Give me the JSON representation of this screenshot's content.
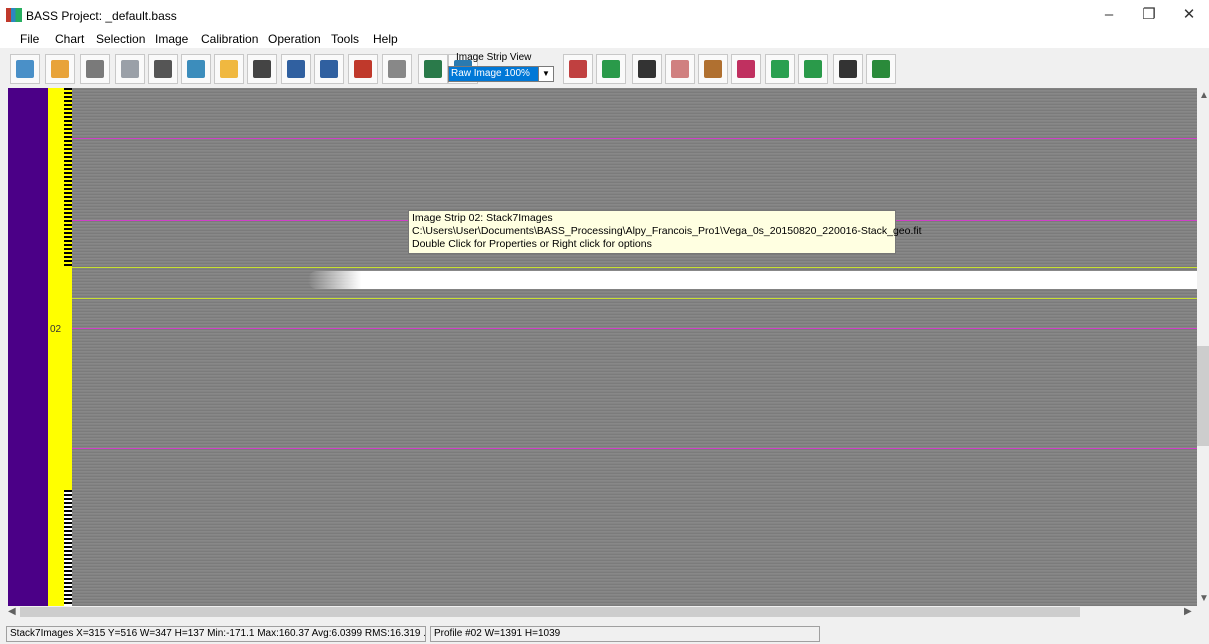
{
  "window": {
    "title": "BASS Project: _default.bass",
    "minimize": "–",
    "restore": "❐",
    "close": "✕"
  },
  "menu": [
    "File",
    "Chart",
    "Selection",
    "Image",
    "Calibration",
    "Operation",
    "Tools",
    "Help"
  ],
  "toolbar": {
    "icons": [
      "new-chart-icon",
      "open-chart-icon",
      "save-chart-icon",
      "tools-icon",
      "binoculars-icon",
      "wave-icon",
      "open-folder-icon",
      "camera-icon",
      "save-icon",
      "save-1d-icon",
      "delete-icon",
      "ruler-icon",
      "crop-icon",
      "refresh-icon",
      "peaks-icon",
      "math-icon",
      "compass-icon",
      "reference-icon",
      "edit-chart-icon",
      "kurucz-icon",
      "flask-icon",
      "abs-icon",
      "film-icon",
      "export-excel-icon"
    ],
    "view_label": "Image Strip View",
    "view_value": "Raw Image 100%"
  },
  "canvas": {
    "strip_number": "02",
    "tooltip_line1": "Image Strip 02: Stack7Images",
    "tooltip_line2": "C:\\Users\\User\\Documents\\BASS_Processing\\Alpy_Francois_Pro1\\Vega_0s_20150820_220016-Stack_geo.fit",
    "tooltip_line3": "Double Click for Properties or Right click for options",
    "colors": {
      "magenta": "#d040c8",
      "yellow_green": "#c8e030",
      "purple": "#4b0087",
      "yellow": "#ffff00"
    }
  },
  "status": {
    "left": "Stack7Images  X=315 Y=516 W=347 H=137 Min:-171.1  Max:160.37  Avg:6.0399  RMS:16.319 ...",
    "right": "Profile #02 W=1391 H=1039"
  }
}
